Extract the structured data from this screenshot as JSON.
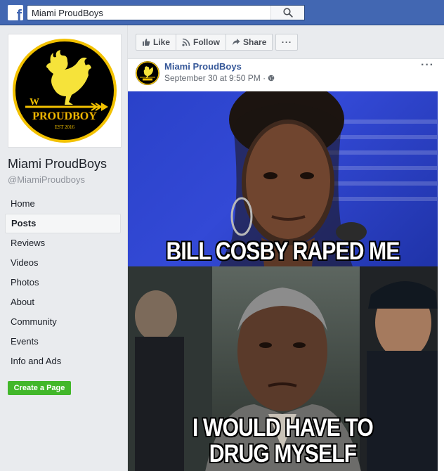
{
  "topbar": {
    "logo": "f",
    "search_value": "Miami ProudBoys",
    "search_icon": "search-icon"
  },
  "page": {
    "name": "Miami ProudBoys",
    "handle": "@MiamiProudboys",
    "logo_text": "PROUDBOY",
    "logo_est": "EST 2016",
    "logo_letter": "W"
  },
  "nav": {
    "items": [
      {
        "label": "Home",
        "active": false
      },
      {
        "label": "Posts",
        "active": true
      },
      {
        "label": "Reviews",
        "active": false
      },
      {
        "label": "Videos",
        "active": false
      },
      {
        "label": "Photos",
        "active": false
      },
      {
        "label": "About",
        "active": false
      },
      {
        "label": "Community",
        "active": false
      },
      {
        "label": "Events",
        "active": false
      },
      {
        "label": "Info and Ads",
        "active": false
      }
    ],
    "create_page": "Create a Page"
  },
  "actions": {
    "like": "Like",
    "follow": "Follow",
    "share": "Share",
    "more": "···"
  },
  "post": {
    "author": "Miami ProudBoys",
    "timestamp": "September 30 at 9:50 PM ·",
    "more": "···",
    "meme_top_text": "BILL COSBY RAPED ME",
    "meme_bottom_line1": "I WOULD HAVE TO",
    "meme_bottom_line2": "DRUG MYSELF"
  },
  "colors": {
    "brand_blue": "#4267b2",
    "link_blue": "#365899",
    "green": "#42b72a",
    "gold": "#f2c100"
  }
}
